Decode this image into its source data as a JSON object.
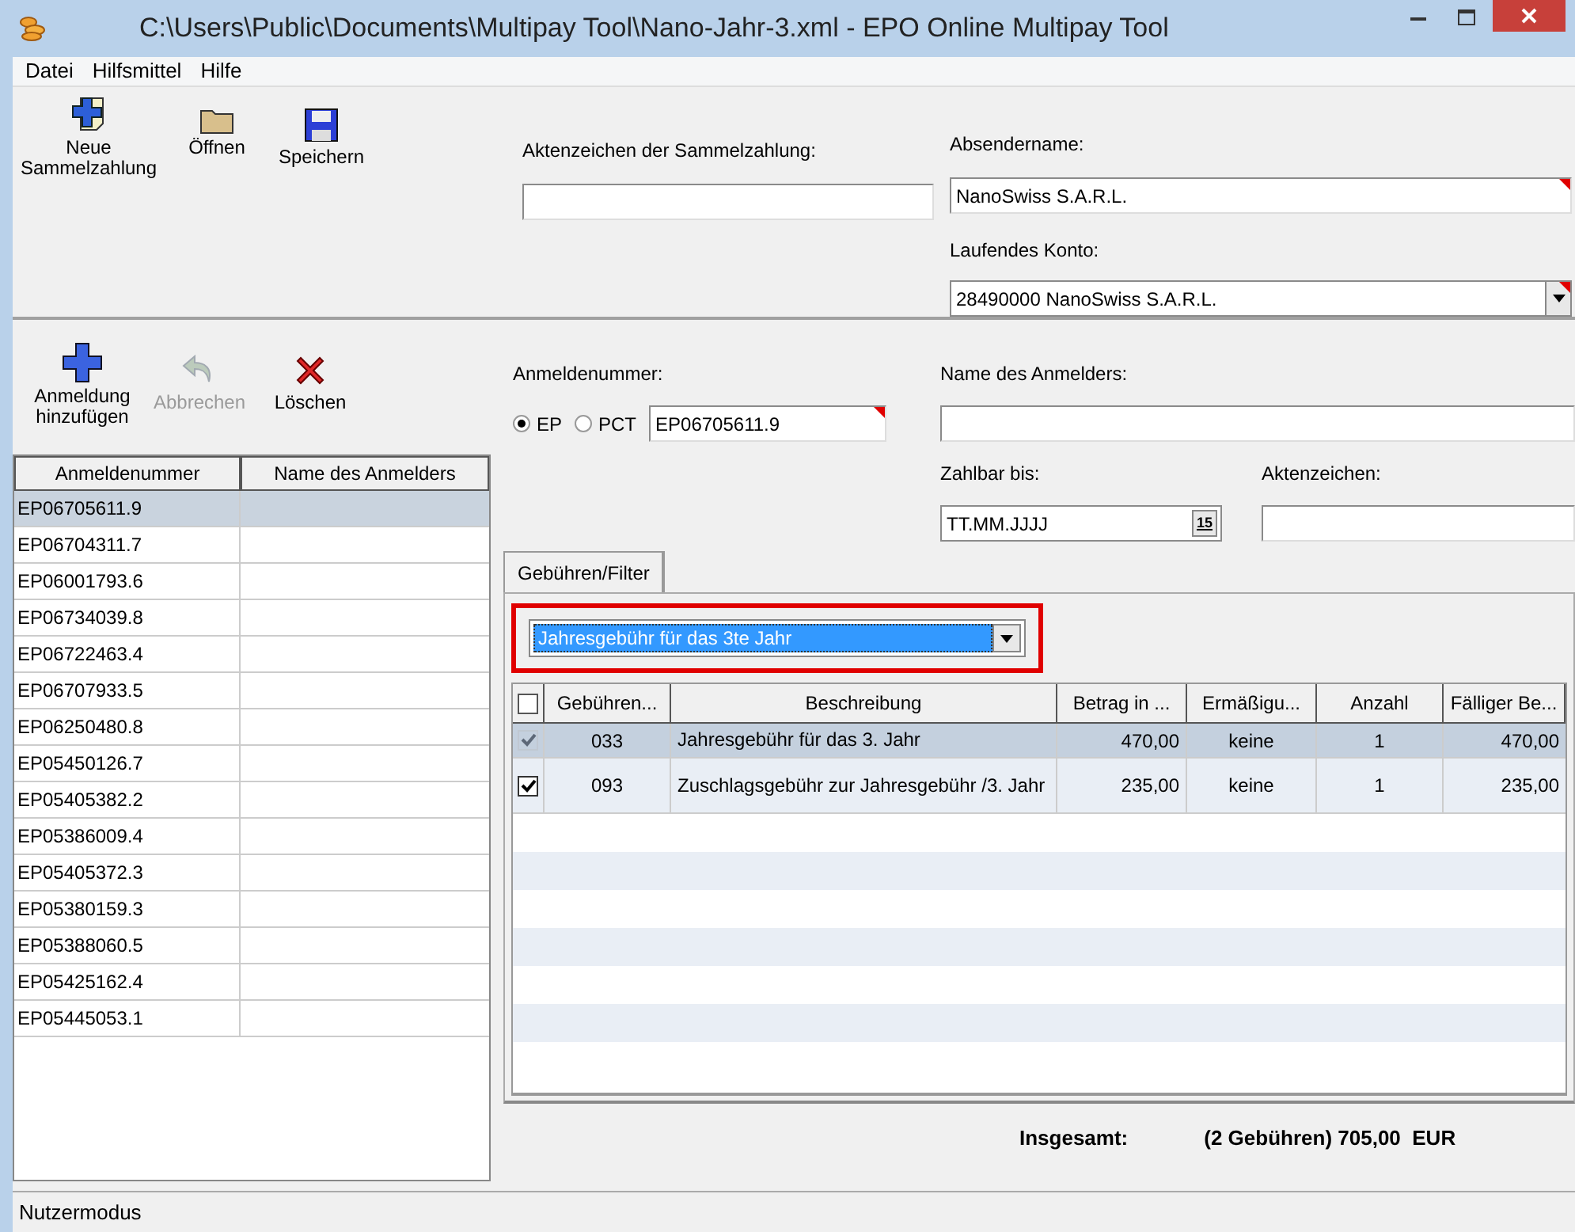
{
  "window": {
    "title": "C:\\Users\\Public\\Documents\\Multipay Tool\\Nano-Jahr-3.xml - EPO Online Multipay Tool"
  },
  "menu": [
    "Datei",
    "Hilfsmittel",
    "Hilfe"
  ],
  "toolbar": [
    {
      "kind": "new",
      "label": "Neue Sammelzahlung",
      "disabled": false
    },
    {
      "kind": "open",
      "label": "Öffnen",
      "disabled": false
    },
    {
      "kind": "save",
      "label": "Speichern",
      "disabled": false
    }
  ],
  "batch": {
    "reference": {
      "label": "Aktenzeichen der Sammelzahlung:",
      "required": false
    },
    "sender": {
      "label": "Absendername:",
      "value": "NanoSwiss S.A.R.L.",
      "required": true
    },
    "account": {
      "label": "Laufendes Konto:",
      "value": "28490000 NanoSwiss S.A.R.L.",
      "required": true
    }
  },
  "application_toolbar": [
    {
      "kind": "add",
      "label": "Anmeldung hinzufügen",
      "disabled": false
    },
    {
      "kind": "undo",
      "label": "Abbrechen",
      "disabled": true
    },
    {
      "kind": "delete",
      "label": "Löschen",
      "disabled": false
    }
  ],
  "applications": {
    "columns": [
      "Anmeldenummer",
      "Name des Anmelders"
    ],
    "rows": [
      {
        "number": "EP06705611.9",
        "selected": true
      },
      {
        "number": "EP06704311.7",
        "selected": false
      },
      {
        "number": "EP06001793.6",
        "selected": false
      },
      {
        "number": "EP06734039.8",
        "selected": false
      },
      {
        "number": "EP06722463.4",
        "selected": false
      },
      {
        "number": "EP06707933.5",
        "selected": false
      },
      {
        "number": "EP06250480.8",
        "selected": false
      },
      {
        "number": "EP05450126.7",
        "selected": false
      },
      {
        "number": "EP05405382.2",
        "selected": false
      },
      {
        "number": "EP05386009.4",
        "selected": false
      },
      {
        "number": "EP05405372.3",
        "selected": false
      },
      {
        "number": "EP05380159.3",
        "selected": false
      },
      {
        "number": "EP05388060.5",
        "selected": false
      },
      {
        "number": "EP05425162.4",
        "selected": false
      },
      {
        "number": "EP05445053.1",
        "selected": false
      }
    ]
  },
  "application": {
    "number_label": "Anmeldenummer:",
    "types": [
      {
        "label": "EP",
        "selected": true
      },
      {
        "label": "PCT",
        "selected": false
      }
    ],
    "number": {
      "value": "EP06705611.9",
      "required": true
    },
    "name_label": "Name des Anmelders:",
    "due_label": "Zahlbar bis:",
    "due_value": "TT.MM.JJJJ",
    "calendar_button": "15",
    "reference_label": "Aktenzeichen:"
  },
  "tabs": [
    {
      "label": "Gebühren/Filter",
      "selected": true
    }
  ],
  "fee_filter": {
    "value": "Jahresgebühr für das 3te Jahr",
    "highlighted": true
  },
  "fees": {
    "all_checked": false,
    "columns": [
      "Gebühren...",
      "Beschreibung",
      "Betrag in ...",
      "Ermäßigu...",
      "Anzahl",
      "Fälliger Be..."
    ],
    "rows": [
      {
        "checked": true,
        "disabled": true,
        "selected": true,
        "code": "033",
        "description": "Jahresgebühr für das 3. Jahr",
        "amount": "470,00",
        "reduction": "keine",
        "count": "1",
        "due": "470,00"
      },
      {
        "checked": true,
        "disabled": false,
        "selected": false,
        "code": "093",
        "description": "Zuschlagsgebühr zur Jahresgebühr /3. Jahr",
        "amount": "235,00",
        "reduction": "keine",
        "count": "1",
        "due": "235,00"
      }
    ]
  },
  "total": {
    "label": "Insgesamt:",
    "value": "(2 Gebühren) 705,00  EUR"
  },
  "status_bar": "Nutzermodus"
}
